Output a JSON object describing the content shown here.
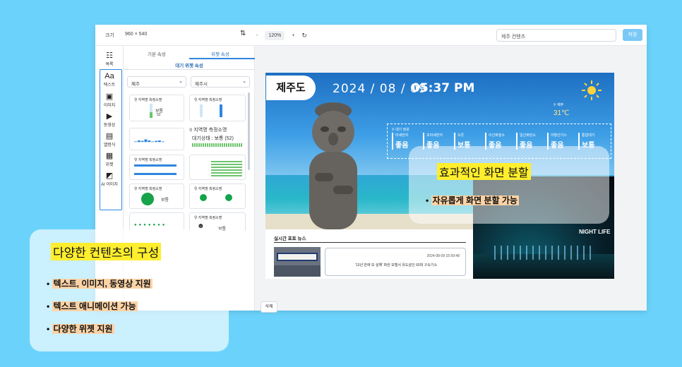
{
  "topbar": {
    "size_label": "크기",
    "size_value": "960 × 540",
    "align_icon": "align-icon",
    "zoom_minus": "-",
    "zoom_value": "120%",
    "zoom_plus": "+",
    "refresh_icon": "refresh-icon",
    "search_value": "제주 컨텐츠",
    "save_label": "저장"
  },
  "rail": {
    "items": [
      {
        "icon": "list-icon",
        "label": "목록"
      },
      {
        "icon": "text-icon",
        "glyph": "Aa",
        "label": "텍스트"
      },
      {
        "icon": "image-icon",
        "label": "이미지"
      },
      {
        "icon": "video-icon",
        "label": "동영상"
      },
      {
        "icon": "album-icon",
        "label": "앨범식"
      },
      {
        "icon": "widget-icon",
        "label": "위젯"
      },
      {
        "icon": "ai-image-icon",
        "label": "AI 이미지"
      }
    ]
  },
  "panel": {
    "tabs": [
      "기본 속성",
      "위젯 속성"
    ],
    "subtab": "대기 위젯 속성",
    "select1": "제주",
    "select2": "제주시",
    "delete_label": "삭제",
    "widget_title": "지역명 측정소명",
    "widget_big_title": "지역명 측정소명",
    "widget_big_status": "대기상태 : 보통 (52)",
    "status_normal": "보통",
    "value_52": "52"
  },
  "canvas": {
    "region": "제주도",
    "date": "2024 / 08 / 09",
    "time": "05:37 PM",
    "weather": {
      "location": "제주",
      "temp": "31℃"
    },
    "air_quality": {
      "title": "대기 정보",
      "items": [
        {
          "label": "미세먼지",
          "value": "좋음"
        },
        {
          "label": "초미세먼지",
          "value": "좋음"
        },
        {
          "label": "오존",
          "value": "보통"
        },
        {
          "label": "이산화질소",
          "value": "좋음"
        },
        {
          "label": "일산화탄소",
          "value": "좋음"
        },
        {
          "label": "아황산가스",
          "value": "좋음"
        },
        {
          "label": "통합대기",
          "value": "보통"
        }
      ]
    },
    "news": {
      "title": "실시간 포토 뉴스",
      "date": "2024-08-09 15:59:48",
      "headline": "'13년 만에 또 살해' 파란 모텔서 유도살인 60대 구속기소"
    },
    "night_label": "NIGHT LIFE"
  },
  "callout_right": {
    "heading": "효과적인 화면 분할",
    "bullets": [
      "자유롭게 화면 분할 가능"
    ]
  },
  "callout_left": {
    "heading": "다양한 컨텐츠의 구성",
    "bullets": [
      "텍스트, 이미지, 동영상 지원",
      "텍스트 애니메이션 가능",
      "다양한 위젯 지원"
    ]
  }
}
